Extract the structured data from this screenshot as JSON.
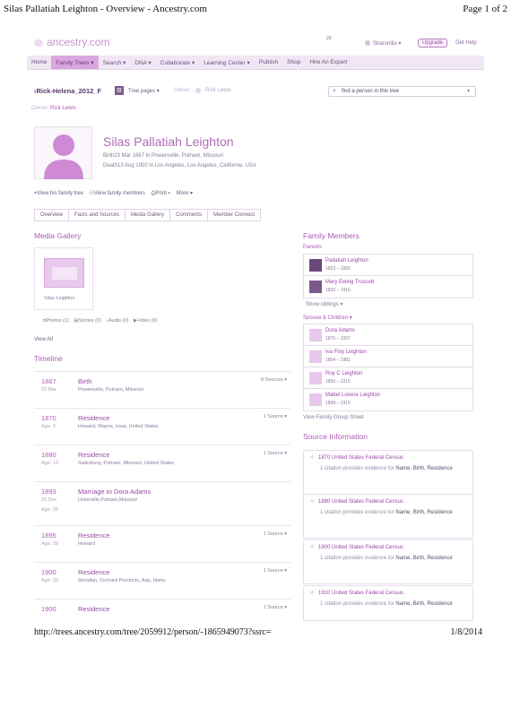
{
  "print_header": {
    "title": "Silas Pallatiah Leighton - Overview - Ancestry.com",
    "page": "Page 1 of 2"
  },
  "print_footer": {
    "url": "http://trees.ancestry.com/tree/2059912/person/-1865949073?ssrc=",
    "date": "1/8/2014"
  },
  "site": {
    "logo": "ancestry.com",
    "notif_count": "29",
    "user": "Sharonlila",
    "upgrade": "Upgrade",
    "help": "Get Help",
    "nav": [
      "Home",
      "Family Trees",
      "Search",
      "DNA",
      "Collaborate",
      "Learning Center",
      "Publish",
      "Shop",
      "Hire An Expert"
    ]
  },
  "tree_bar": {
    "tree_name": "Rick-Helena_2012_F",
    "tree_pages": "Tree pages",
    "owner_label": "Owner:",
    "owner_name": "Rick Lewis",
    "search_placeholder": "find a person in this tree"
  },
  "owner_line": {
    "label": "Owner:",
    "name": "Rick Lewis"
  },
  "person": {
    "name": "Silas Pallatiah Leighton",
    "birth_label": "Birth",
    "birth": "23 Mar 1867 in Powersville, Putnam, Missouri",
    "death_label": "Death",
    "death": "13 Aug 1950 in Los Angeles, Los Angeles, California, USA"
  },
  "actions": [
    "View his family tree",
    "View family members",
    "Print",
    "More"
  ],
  "tabs": [
    "Overview",
    "Facts and Sources",
    "Media Gallery",
    "Comments",
    "Member Connect"
  ],
  "media": {
    "title": "Media Gallery",
    "thumb_caption": "Silas Leighton",
    "counts": [
      "Photos (1)",
      "Stories (0)",
      "Audio (0)",
      "Video (0)"
    ],
    "view_all": "View All"
  },
  "timeline": {
    "title": "Timeline",
    "items": [
      {
        "year": "1867",
        "date": "23 Mar",
        "event": "Birth",
        "place": "Powersville, Putnam, Missouri",
        "sources": "8 Sources"
      },
      {
        "year": "1870",
        "date": "Age: 3",
        "event": "Residence",
        "place": "Howard, Wayne, Iowa, United States",
        "sources": "1 Source"
      },
      {
        "year": "1880",
        "date": "Age: 13",
        "event": "Residence",
        "place": "Galesburg, Putnam, Missouri, United States",
        "sources": "1 Source"
      },
      {
        "year": "1893",
        "date": "25 Dec",
        "age": "Age: 26",
        "event": "Marriage to Dora Adams",
        "place": "Unionville,Putnam,Missouri",
        "sources": ""
      },
      {
        "year": "1895",
        "date": "Age: 28",
        "event": "Residence",
        "place": "Howard",
        "sources": "1 Source"
      },
      {
        "year": "1900",
        "date": "Age: 33",
        "event": "Residence",
        "place": "Meridian, Orchard Precincts, Ada, Idaho",
        "sources": "1 Source"
      },
      {
        "year": "1900",
        "date": "",
        "event": "Residence",
        "place": "",
        "sources": "1 Source"
      }
    ]
  },
  "family": {
    "title": "Family Members",
    "parents_label": "Parents",
    "parents": [
      {
        "name": "Pallatiah Leighton",
        "years": "1823 – 1892"
      },
      {
        "name": "Mary Ewing Truscott",
        "years": "1829 – 1916"
      }
    ],
    "show_siblings": "Show siblings",
    "spouse_label": "Spouse & Children",
    "spouse_children": [
      {
        "name": "Dora Adams",
        "years": "1875 – 1937"
      },
      {
        "name": "Iva Floy Leighton",
        "years": "1894 – 1981"
      },
      {
        "name": "Roy C Leighton",
        "years": "1896 – 1915"
      },
      {
        "name": "Mabel Lorene Leighton",
        "years": "1898 – 1919"
      }
    ],
    "view_group_sheet": "View Family Group Sheet"
  },
  "sources": {
    "title": "Source Information",
    "items": [
      {
        "title": "1870 United States Federal Census",
        "cite": "1 citation provides evidence for",
        "facts": "Name, Birth, Residence"
      },
      {
        "title": "1880 United States Federal Census",
        "cite": "1 citation provides evidence for",
        "facts": "Name, Birth, Residence"
      },
      {
        "title": "1900 United States Federal Census",
        "cite": "1 citation provides evidence for",
        "facts": "Name, Birth, Residence"
      },
      {
        "title": "1910 United States Federal Census",
        "cite": "1 citation provides evidence for",
        "facts": "Name, Birth, Residence"
      }
    ]
  },
  "colors": {
    "accent": "#b05ab8",
    "nav_bg": "#f1e7f4",
    "active_tab": "#d9a7dd"
  }
}
